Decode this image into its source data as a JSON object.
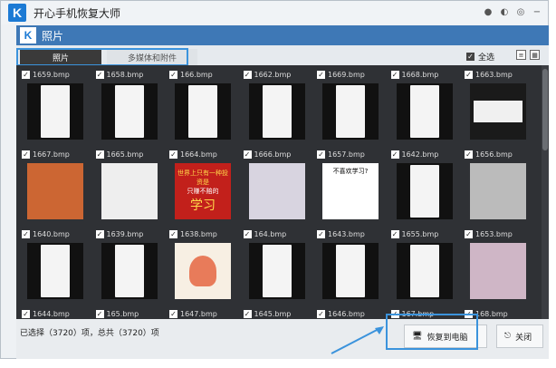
{
  "app": {
    "title": "开心手机恢复大师",
    "logo": "K"
  },
  "sub": {
    "title": "照片",
    "logo": "K"
  },
  "tabs": [
    {
      "label": "照片"
    },
    {
      "label": "多媒体和附件"
    }
  ],
  "select_all": "全选",
  "photos": [
    {
      "name": "1659.bmp"
    },
    {
      "name": "1658.bmp"
    },
    {
      "name": "166.bmp"
    },
    {
      "name": "1662.bmp"
    },
    {
      "name": "1669.bmp"
    },
    {
      "name": "1668.bmp"
    },
    {
      "name": "1663.bmp"
    },
    {
      "name": "1667.bmp"
    },
    {
      "name": "1665.bmp"
    },
    {
      "name": "1664.bmp"
    },
    {
      "name": "1666.bmp"
    },
    {
      "name": "1657.bmp"
    },
    {
      "name": "1642.bmp"
    },
    {
      "name": "1656.bmp"
    },
    {
      "name": "1640.bmp"
    },
    {
      "name": "1639.bmp"
    },
    {
      "name": "1638.bmp"
    },
    {
      "name": "164.bmp"
    },
    {
      "name": "1643.bmp"
    },
    {
      "name": "1655.bmp"
    },
    {
      "name": "1653.bmp"
    },
    {
      "name": "1644.bmp"
    },
    {
      "name": "165.bmp"
    },
    {
      "name": "1647.bmp"
    },
    {
      "name": "1645.bmp"
    },
    {
      "name": "1646.bmp"
    },
    {
      "name": "167.bmp"
    },
    {
      "name": "168.bmp"
    }
  ],
  "thumb_texts": {
    "meme2": "不喜欢学习?",
    "meme3_top": "世界上只有一种投资是",
    "meme3_mid": "只赚不赔的",
    "meme3_big": "学习"
  },
  "status": "已选择（3720）项，总共（3720）项",
  "buttons": {
    "recover": "恢复到电脑",
    "close": "关闭"
  },
  "colors": {
    "accent": "#3e78b6",
    "highlight": "#3b93dc",
    "grid_bg": "#2f3135"
  }
}
